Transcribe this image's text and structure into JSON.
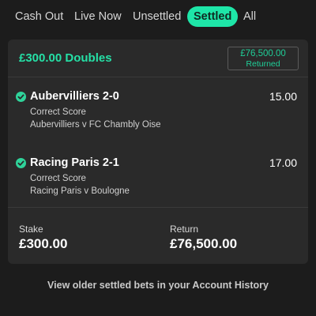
{
  "tabs": [
    {
      "label": "Cash Out",
      "active": false
    },
    {
      "label": "Live Now",
      "active": false
    },
    {
      "label": "Unsettled",
      "active": false
    },
    {
      "label": "Settled",
      "active": true
    },
    {
      "label": "All",
      "active": false
    }
  ],
  "bet": {
    "title": "£300.00 Doubles",
    "returned_amount": "£76,500.00",
    "returned_label": "Returned",
    "selections": [
      {
        "title": "Aubervilliers 2-0",
        "odds": "15.00",
        "market": "Correct Score",
        "event": "Aubervilliers v FC Chambly Oise",
        "status_icon": "check-circle-icon"
      },
      {
        "title": "Racing Paris 2-1",
        "odds": "17.00",
        "market": "Correct Score",
        "event": "Racing Paris v Boulogne",
        "status_icon": "check-circle-icon"
      }
    ],
    "stake_label": "Stake",
    "stake_value": "£300.00",
    "return_label": "Return",
    "return_value": "£76,500.00"
  },
  "footer": {
    "history_link": "View older settled bets in your Account History"
  },
  "colors": {
    "accent": "#1ee6a8",
    "background": "#1c1c1c",
    "card": "#2a2a2a"
  }
}
